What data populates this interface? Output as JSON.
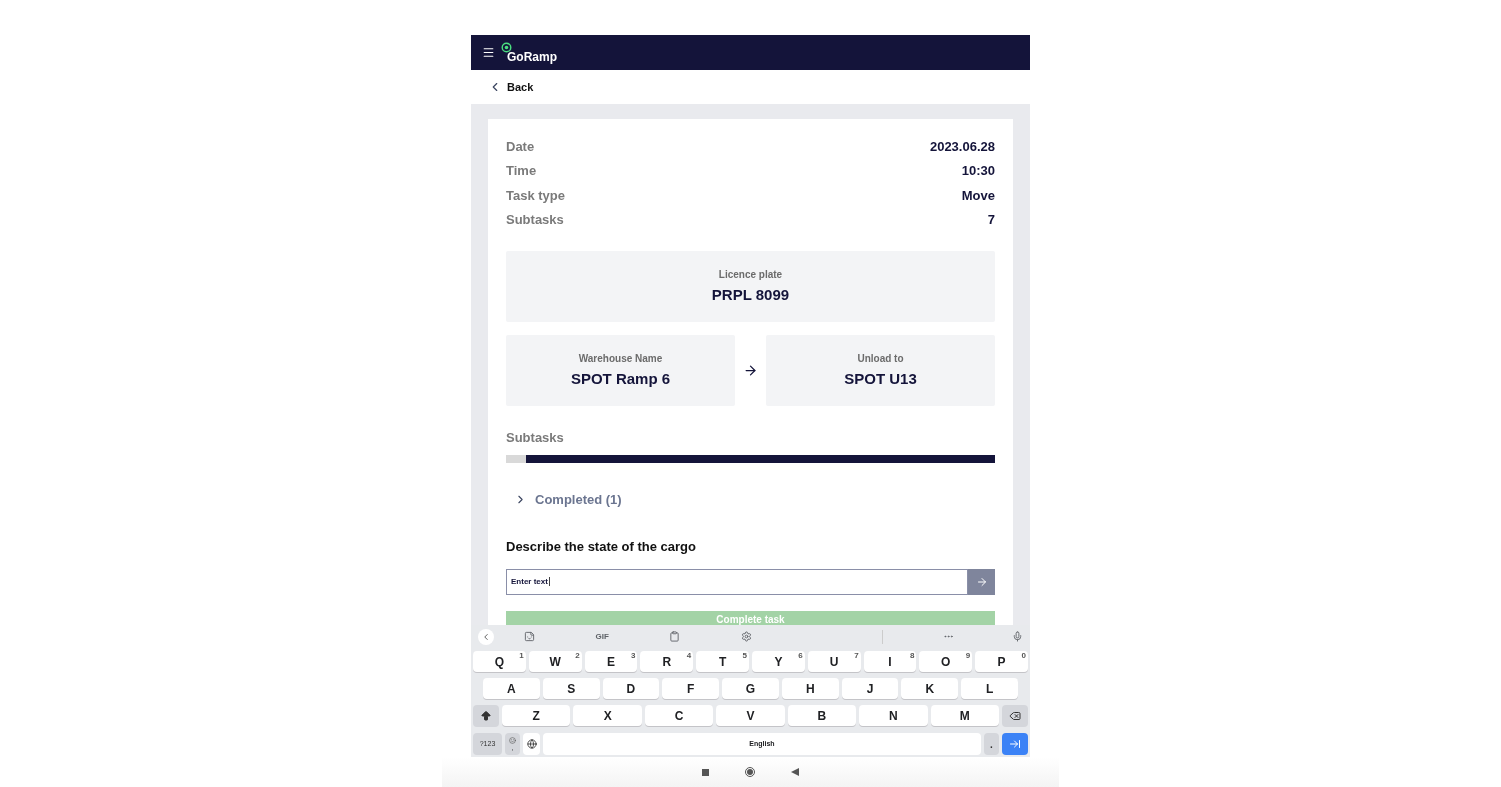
{
  "app": {
    "brand": "GoRamp"
  },
  "nav": {
    "back": "Back"
  },
  "details": [
    {
      "label": "Date",
      "value": "2023.06.28"
    },
    {
      "label": "Time",
      "value": "10:30"
    },
    {
      "label": "Task type",
      "value": "Move"
    },
    {
      "label": "Subtasks",
      "value": "7"
    }
  ],
  "licence": {
    "label": "Licence plate",
    "value": "PRPL 8099"
  },
  "route": {
    "from": {
      "label": "Warehouse Name",
      "value": "SPOT Ramp 6"
    },
    "to": {
      "label": "Unload to",
      "value": "SPOT U13"
    }
  },
  "subtasks": {
    "title": "Subtasks",
    "level": 0.96,
    "completed": {
      "label": "Completed (1)",
      "expanded": false
    }
  },
  "cargo": {
    "question": "Describe the state of the cargo",
    "value": "Enter text"
  },
  "complete_button": {
    "label": "Complete task",
    "disabled": true
  },
  "keyboard": {
    "toolbar_gif": "GIF",
    "rows": [
      [
        {
          "key": "Q",
          "hint": "1"
        },
        {
          "key": "W",
          "hint": "2"
        },
        {
          "key": "E",
          "hint": "3"
        },
        {
          "key": "R",
          "hint": "4"
        },
        {
          "key": "T",
          "hint": "5"
        },
        {
          "key": "Y",
          "hint": "6"
        },
        {
          "key": "U",
          "hint": "7"
        },
        {
          "key": "I",
          "hint": "8"
        },
        {
          "key": "O",
          "hint": "9"
        },
        {
          "key": "P",
          "hint": "0"
        }
      ],
      [
        {
          "key": "A"
        },
        {
          "key": "S"
        },
        {
          "key": "D"
        },
        {
          "key": "F"
        },
        {
          "key": "G"
        },
        {
          "key": "H"
        },
        {
          "key": "J"
        },
        {
          "key": "K"
        },
        {
          "key": "L"
        }
      ],
      [
        {
          "key": "Z"
        },
        {
          "key": "X"
        },
        {
          "key": "C"
        },
        {
          "key": "V"
        },
        {
          "key": "B"
        },
        {
          "key": "N"
        },
        {
          "key": "M"
        }
      ]
    ],
    "symbols": "?123",
    "comma": ",",
    "space": "English",
    "period": "."
  }
}
